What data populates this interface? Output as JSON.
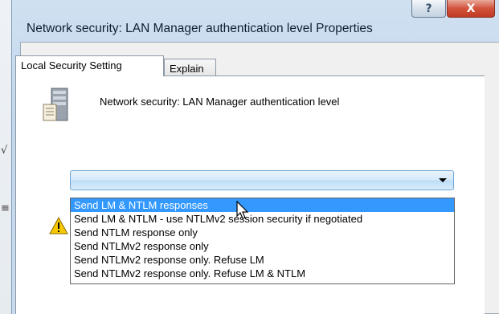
{
  "window": {
    "title": "Network security: LAN Manager authentication level Properties",
    "help_glyph": "?",
    "close_glyph": "X"
  },
  "background": {
    "marks": [
      "√",
      "≡"
    ]
  },
  "tabs": [
    {
      "label": "Local Security Setting",
      "active": true
    },
    {
      "label": "Explain",
      "active": false
    }
  ],
  "policy": {
    "heading": "Network security: LAN Manager authentication level",
    "icon": "server-icon"
  },
  "combo": {
    "value": ""
  },
  "dropdown": {
    "options": [
      "Send LM & NTLM responses",
      "Send LM & NTLM - use NTLMv2 session security if negotiated",
      "Send NTLM response only",
      "Send NTLMv2 response only",
      "Send NTLMv2 response only. Refuse LM",
      "Send NTLMv2 response only. Refuse LM & NTLM"
    ],
    "highlighted_index": 0
  },
  "colors": {
    "highlight": "#3399ff",
    "close_button": "#c13a24"
  }
}
